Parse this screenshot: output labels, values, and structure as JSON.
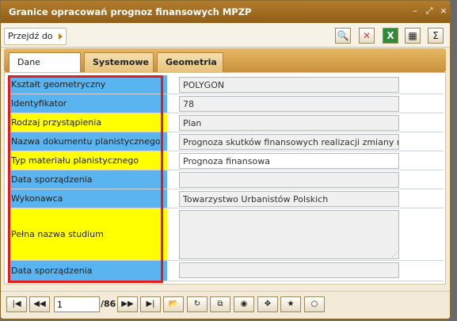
{
  "window": {
    "title": "Granice opracowań prognoz finansowych MPZP",
    "controls": [
      "minimize-icon",
      "restore-icon",
      "close-icon"
    ]
  },
  "toolbar": {
    "goto_label": "Przejdź do",
    "buttons": [
      "zoom-to-feature-icon",
      "remove-icon",
      "excel-export-icon",
      "table-icon",
      "sum-icon"
    ]
  },
  "tabs": [
    {
      "label": "Dane opisowe",
      "active": true
    },
    {
      "label": "Systemowe",
      "active": false
    },
    {
      "label": "Geometria",
      "active": false
    }
  ],
  "fields": [
    {
      "label": "Kształt geometryczny",
      "value": "POLYGON",
      "color": "#5ab4f0",
      "readonly": true
    },
    {
      "label": "Identyfikator",
      "value": "78",
      "color": "#5ab4f0",
      "readonly": true
    },
    {
      "label": "Rodzaj przystąpienia",
      "value": "Plan",
      "color": "#ffff00",
      "readonly": false
    },
    {
      "label": "Nazwa dokumentu planistycznego",
      "value": "Prognoza skutków finansowych realizacji zmiany miejsco",
      "color": "#5ab4f0",
      "readonly": false
    },
    {
      "label": "Typ materiału planistycznego",
      "value": "Prognoza finansowa",
      "color": "#ffff00",
      "readonly": false
    },
    {
      "label": "Data sporządzenia",
      "value": "",
      "color": "#5ab4f0",
      "readonly": true
    },
    {
      "label": "Wykonawca",
      "value": "Towarzystwo Urbanistów Polskich",
      "color": "#5ab4f0",
      "readonly": true
    },
    {
      "label": "Pełna nazwa studium",
      "value": "",
      "color": "#ffff00",
      "readonly": true
    },
    {
      "label": "Data sporządzenia",
      "value": "",
      "color": "#5ab4f0",
      "readonly": true
    }
  ],
  "pager": {
    "current_page": "1",
    "total": "/86"
  },
  "colors": {
    "title_bar": "#a06c20",
    "blue_label": "#5ab4f0",
    "yellow_label": "#ffff00",
    "highlight_frame": "#e41b1b"
  }
}
